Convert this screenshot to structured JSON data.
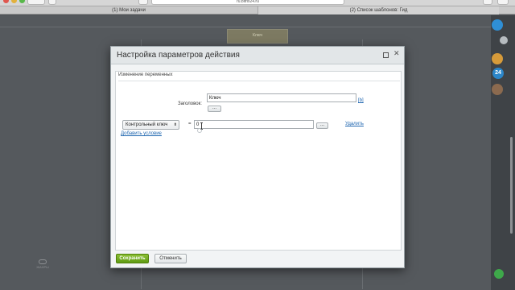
{
  "browser": {
    "url": "ru.bitrix24.ru",
    "tabs": [
      {
        "label": "(1) Мои задачи"
      },
      {
        "label": "(2) Список шаблонов: Гид"
      }
    ]
  },
  "background": {
    "box_title": "Ключ",
    "logo_text": "ЖАНРЫ",
    "badge_count": "24"
  },
  "dialog": {
    "title": "Настройка параметров действия",
    "section_label": "Изменение переменных",
    "title_field": {
      "label": "Заголовок:",
      "value": "Ключ",
      "insert_label": "...",
      "link": "[b]"
    },
    "condition": {
      "variable": "Контрольный ключ",
      "operator": "=",
      "value": "0",
      "insert_label": "...",
      "delete_link": "Удалить"
    },
    "add_condition_link": "Добавить условие",
    "save_label": "Сохранить",
    "cancel_label": "Отменить"
  },
  "colors": {
    "save_button": "#6fa81f",
    "link": "#2067b0",
    "badge": "#2c86c9"
  }
}
